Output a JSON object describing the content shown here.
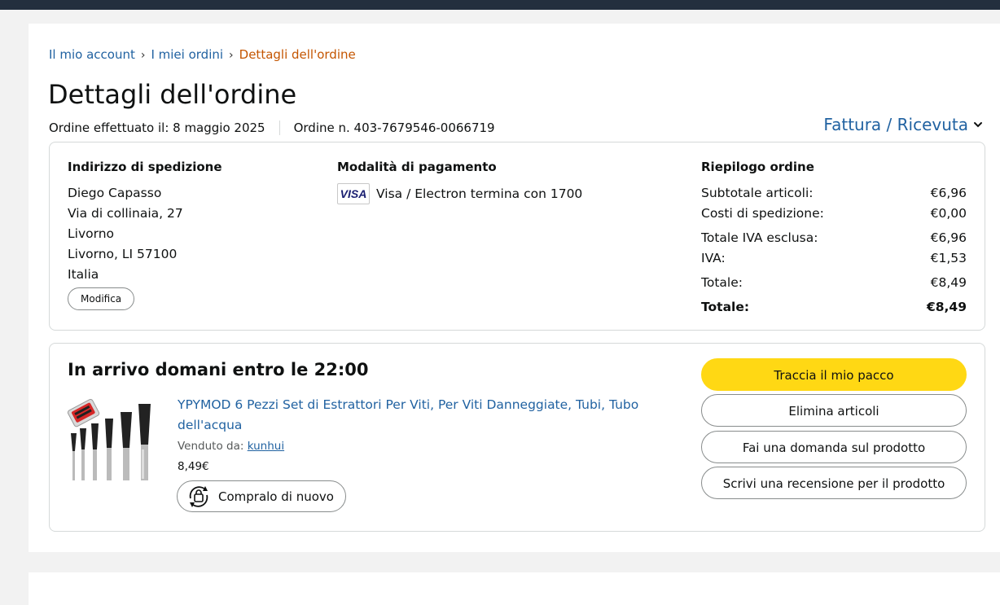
{
  "breadcrumb": {
    "items": [
      "Il mio account",
      "I miei ordini"
    ],
    "current": "Dettagli dell'ordine",
    "separator": "›"
  },
  "page_title": "Dettagli dell'ordine",
  "order": {
    "placed_label": "Ordine effettuato il: 8 maggio 2025",
    "number_label": "Ordine n. 403-7679546-0066719"
  },
  "invoice_label": "Fattura / Ricevuta",
  "shipping": {
    "heading": "Indirizzo di spedizione",
    "lines": [
      "Diego Capasso",
      "Via di collinaia, 27",
      "Livorno",
      "Livorno, LI 57100",
      "Italia"
    ],
    "edit_label": "Modifica"
  },
  "payment": {
    "heading": "Modalità di pagamento",
    "card_logo": "VISA",
    "card_text": "Visa / Electron termina con 1700"
  },
  "summary": {
    "heading": "Riepilogo ordine",
    "rows": [
      {
        "label": "Subtotale articoli:",
        "value": "€6,96"
      },
      {
        "label": "Costi di spedizione:",
        "value": "€0,00"
      },
      {
        "label": "Totale IVA esclusa:",
        "value": "€6,96"
      },
      {
        "label": "IVA:",
        "value": "€1,53"
      },
      {
        "label": "Totale:",
        "value": "€8,49"
      },
      {
        "label": "Totale:",
        "value": "€8,49"
      }
    ]
  },
  "shipment": {
    "status": "In arrivo domani entro le 22:00",
    "product_title": "YPYMOD 6 Pezzi Set di Estrattori Per Viti, Per Viti Danneggiate, Tubi, Tubo dell'acqua",
    "sold_by_label": "Venduto da:",
    "seller": "kunhui",
    "price": "8,49€",
    "buy_again_label": "Compralo di nuovo",
    "actions": {
      "track": "Traccia il mio pacco",
      "delete": "Elimina articoli",
      "ask": "Fai una domanda sul prodotto",
      "review": "Scrivi una recensione per il prodotto"
    }
  },
  "colors": {
    "link": "#2162a1",
    "breadcrumb_current": "#c45500",
    "primary_button": "#ffd814",
    "topbar": "#232f3e"
  }
}
